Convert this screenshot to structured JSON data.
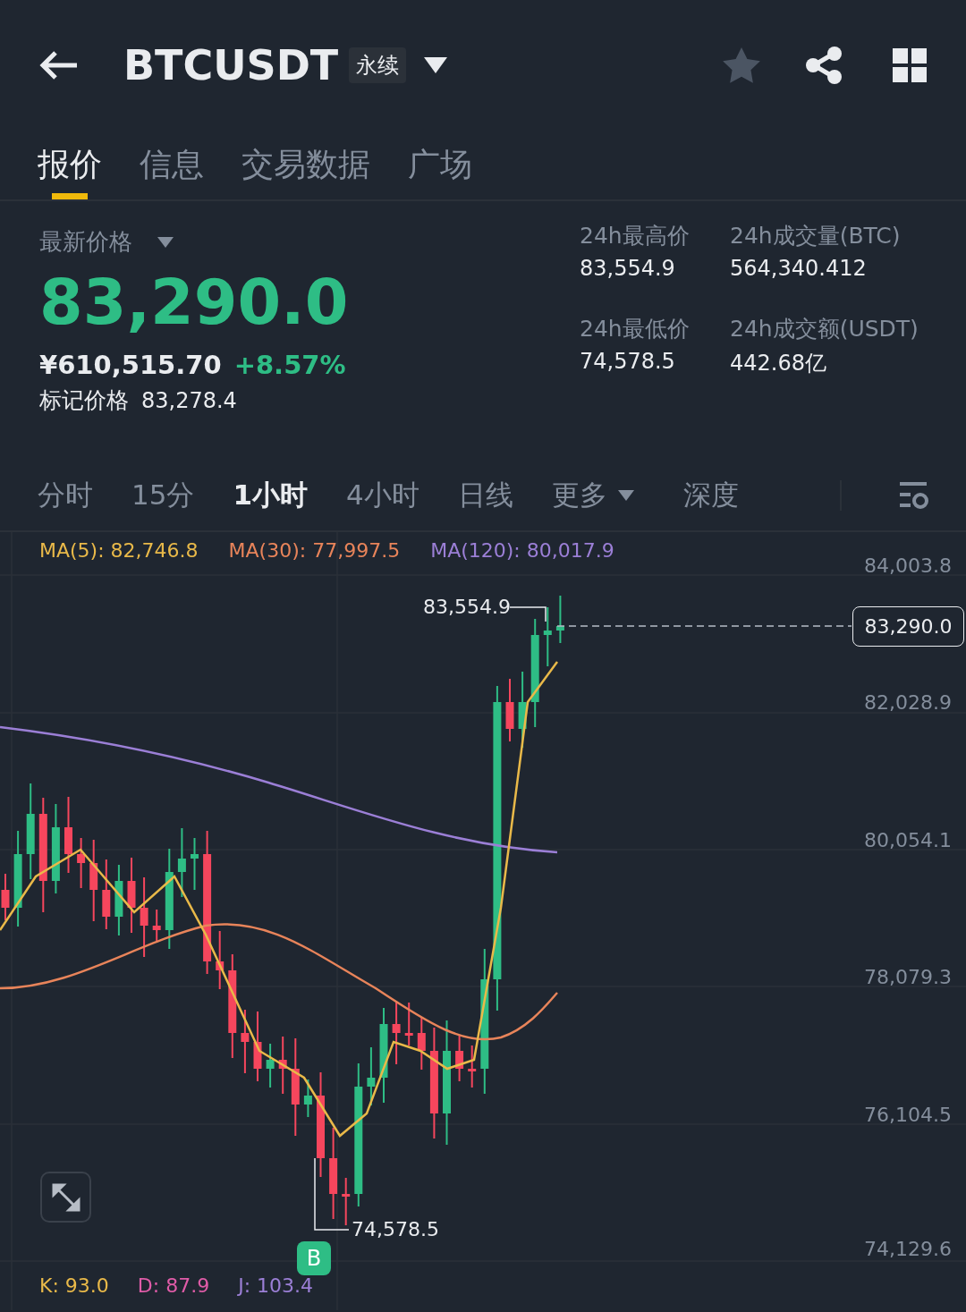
{
  "header": {
    "symbol": "BTCUSDT",
    "contract_tag": "永续"
  },
  "tabs": [
    {
      "label": "报价",
      "selected": true
    },
    {
      "label": "信息",
      "selected": false
    },
    {
      "label": "交易数据",
      "selected": false
    },
    {
      "label": "广场",
      "selected": false
    }
  ],
  "price": {
    "label": "最新价格",
    "last": "83,290.0",
    "cny": "¥610,515.70",
    "change": "+8.57%",
    "mark_label": "标记价格",
    "mark_value": "83,278.4"
  },
  "stats": [
    {
      "label": "24h最高价",
      "value": "83,554.9"
    },
    {
      "label": "24h成交量(BTC)",
      "value": "564,340.412"
    },
    {
      "label": "24h最低价",
      "value": "74,578.5"
    },
    {
      "label": "24h成交额(USDT)",
      "value": "442.68亿"
    }
  ],
  "intervals": [
    {
      "label": "分时",
      "kind": "interval",
      "selected": false
    },
    {
      "label": "15分",
      "kind": "interval",
      "selected": false
    },
    {
      "label": "1小时",
      "kind": "interval",
      "selected": true
    },
    {
      "label": "4小时",
      "kind": "interval",
      "selected": false
    },
    {
      "label": "日线",
      "kind": "interval",
      "selected": false
    },
    {
      "label": "更多",
      "kind": "dropdown",
      "selected": false
    },
    {
      "label": "深度",
      "kind": "view",
      "selected": false
    }
  ],
  "chart": {
    "ma": [
      {
        "label": "MA(5): 82,746.8",
        "color": "#e9b949"
      },
      {
        "label": "MA(30): 77,997.5",
        "color": "#e8845a"
      },
      {
        "label": "MA(120): 80,017.9",
        "color": "#9b7fd6"
      }
    ],
    "price_axis": [
      "84,003.8",
      "82,028.9",
      "80,054.1",
      "78,079.3",
      "76,104.5",
      "74,129.6"
    ],
    "high_label": "83,554.9",
    "low_label": "74,578.5",
    "current_price": "83,290.0",
    "signal": "B"
  },
  "indicators": [
    {
      "label": "K: 93.0",
      "color": "#e9b949"
    },
    {
      "label": "D: 87.9",
      "color": "#e05ca8"
    },
    {
      "label": "J: 103.4",
      "color": "#9b7fd6"
    }
  ]
}
